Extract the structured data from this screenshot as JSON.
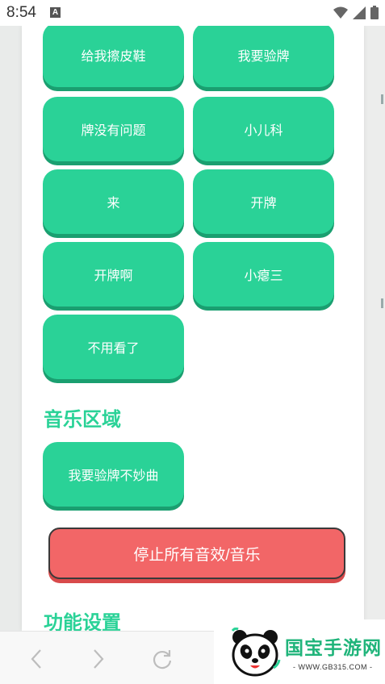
{
  "status_bar": {
    "time": "8:54",
    "notification_icon": "a-icon",
    "icons": [
      "wifi-icon",
      "signal-icon",
      "battery-icon"
    ]
  },
  "sound_buttons": [
    {
      "label": "给我擦皮鞋"
    },
    {
      "label": "我要验牌"
    },
    {
      "label": "牌没有问题"
    },
    {
      "label": "小儿科"
    },
    {
      "label": "来"
    },
    {
      "label": "开牌"
    },
    {
      "label": "开牌啊"
    },
    {
      "label": "小瘪三"
    },
    {
      "label": "不用看了"
    }
  ],
  "music_section": {
    "title": "音乐区域",
    "buttons": [
      {
        "label": "我要验牌不妙曲"
      }
    ]
  },
  "stop_button": {
    "label": "停止所有音效/音乐"
  },
  "settings_section": {
    "title": "功能设置"
  },
  "browser_nav": {
    "icons": [
      "back-icon",
      "forward-icon",
      "refresh-icon"
    ]
  },
  "watermark": {
    "brand": "国宝手游网",
    "url": "- WWW.GB315.COM -"
  },
  "colors": {
    "accent_green": "#2ad297",
    "green_shadow": "#1a9f70",
    "stop_red": "#f26667"
  }
}
